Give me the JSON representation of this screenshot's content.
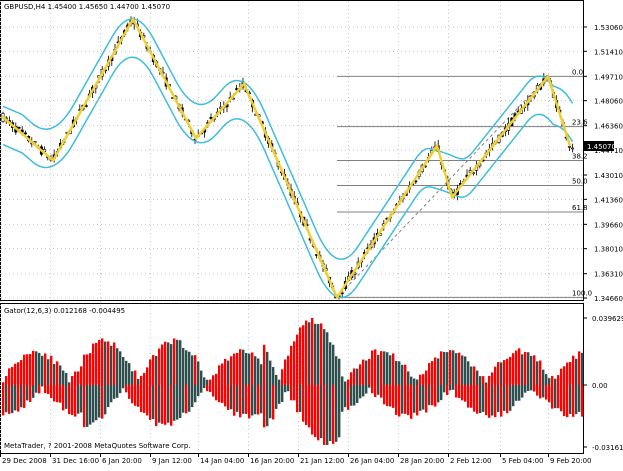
{
  "chart": {
    "symbol_header": "GBPUSD,H4  1.45400 1.45650 1.44700 1.45070",
    "current_price": "1.45070",
    "price_ticks": [
      "1.53060",
      "1.51410",
      "1.49710",
      "1.48060",
      "1.46360",
      "1.44710",
      "1.43010",
      "1.41360",
      "1.39660",
      "1.38010",
      "1.36310",
      "1.34660"
    ],
    "fib_levels": [
      "0.0",
      "23.6",
      "38.2",
      "50.0",
      "61.8",
      "100.0"
    ],
    "time_ticks": [
      "29 Dec 2008",
      "31 Dec 16:00",
      "6 Jan 20:00",
      "9 Jan 12:00",
      "14 Jan 04:00",
      "16 Jan 20:00",
      "21 Jan 12:00",
      "26 Jan 04:00",
      "28 Jan 20:00",
      "2 Feb 12:00",
      "5 Feb 04:00",
      "9 Feb 20:00"
    ]
  },
  "indicator": {
    "label": "Gator(12,6,3) 0.012168 -0.004495",
    "ticks": [
      "0.039629",
      "0.00",
      "-0.03161"
    ]
  },
  "copyright": "MetaTrader, ? 2001-2008 MetaQuotes Software Corp.",
  "colors": {
    "up_bar": "#ff0000",
    "down_bar": "#2f4f4f",
    "bands": "#3ebde0",
    "zigzag": "#f0d030",
    "fib": "#808080",
    "candles": "#000000"
  },
  "chart_data": {
    "type": "line",
    "price_range": [
      1.3466,
      1.5306
    ],
    "indicator_range": [
      -0.03161,
      0.039629
    ],
    "zigzag_prices": [
      1.47,
      1.44,
      1.536,
      1.455,
      1.492,
      1.347,
      1.45,
      1.415,
      1.497,
      1.45
    ],
    "fib_prices": [
      1.4971,
      1.463,
      1.44,
      1.423,
      1.405,
      1.347
    ]
  }
}
